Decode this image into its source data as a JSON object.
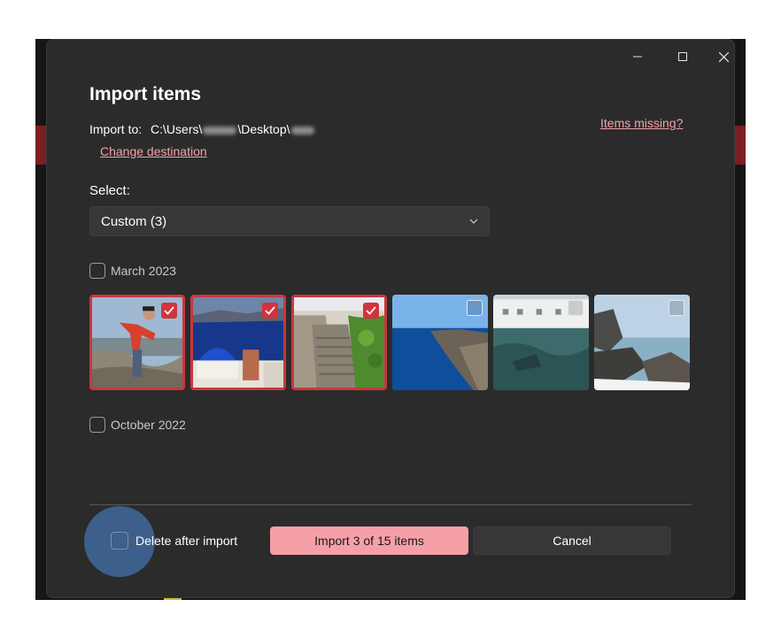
{
  "window": {
    "minimize_icon": "minimize-icon",
    "maximize_icon": "maximize-icon",
    "close_icon": "close-icon"
  },
  "dialog": {
    "title": "Import items",
    "import_to_label": "Import to:",
    "path_prefix": "C:\\Users\\",
    "path_middle": "\\Desktop\\",
    "change_destination": "Change destination",
    "items_missing": "Items missing?",
    "select_label": "Select:",
    "select_value": "Custom (3)"
  },
  "groups": [
    {
      "label": "March 2023",
      "photos": [
        {
          "subject": "person in red jacket on cliff",
          "selected": true
        },
        {
          "subject": "blue dome church",
          "selected": true
        },
        {
          "subject": "stone stairs with plants",
          "selected": true
        },
        {
          "subject": "coastline cliffs",
          "selected": false
        },
        {
          "subject": "waterfront white buildings",
          "selected": false
        },
        {
          "subject": "rocks and waves",
          "selected": false
        }
      ]
    },
    {
      "label": "October 2022",
      "photos": []
    }
  ],
  "footer": {
    "delete_after_import": "Delete after import",
    "import_button": "Import 3 of 15 items",
    "cancel_button": "Cancel"
  },
  "colors": {
    "accent": "#f4a0a6",
    "selection_border": "#c8373d",
    "dialog_bg": "#2b2b2b"
  }
}
